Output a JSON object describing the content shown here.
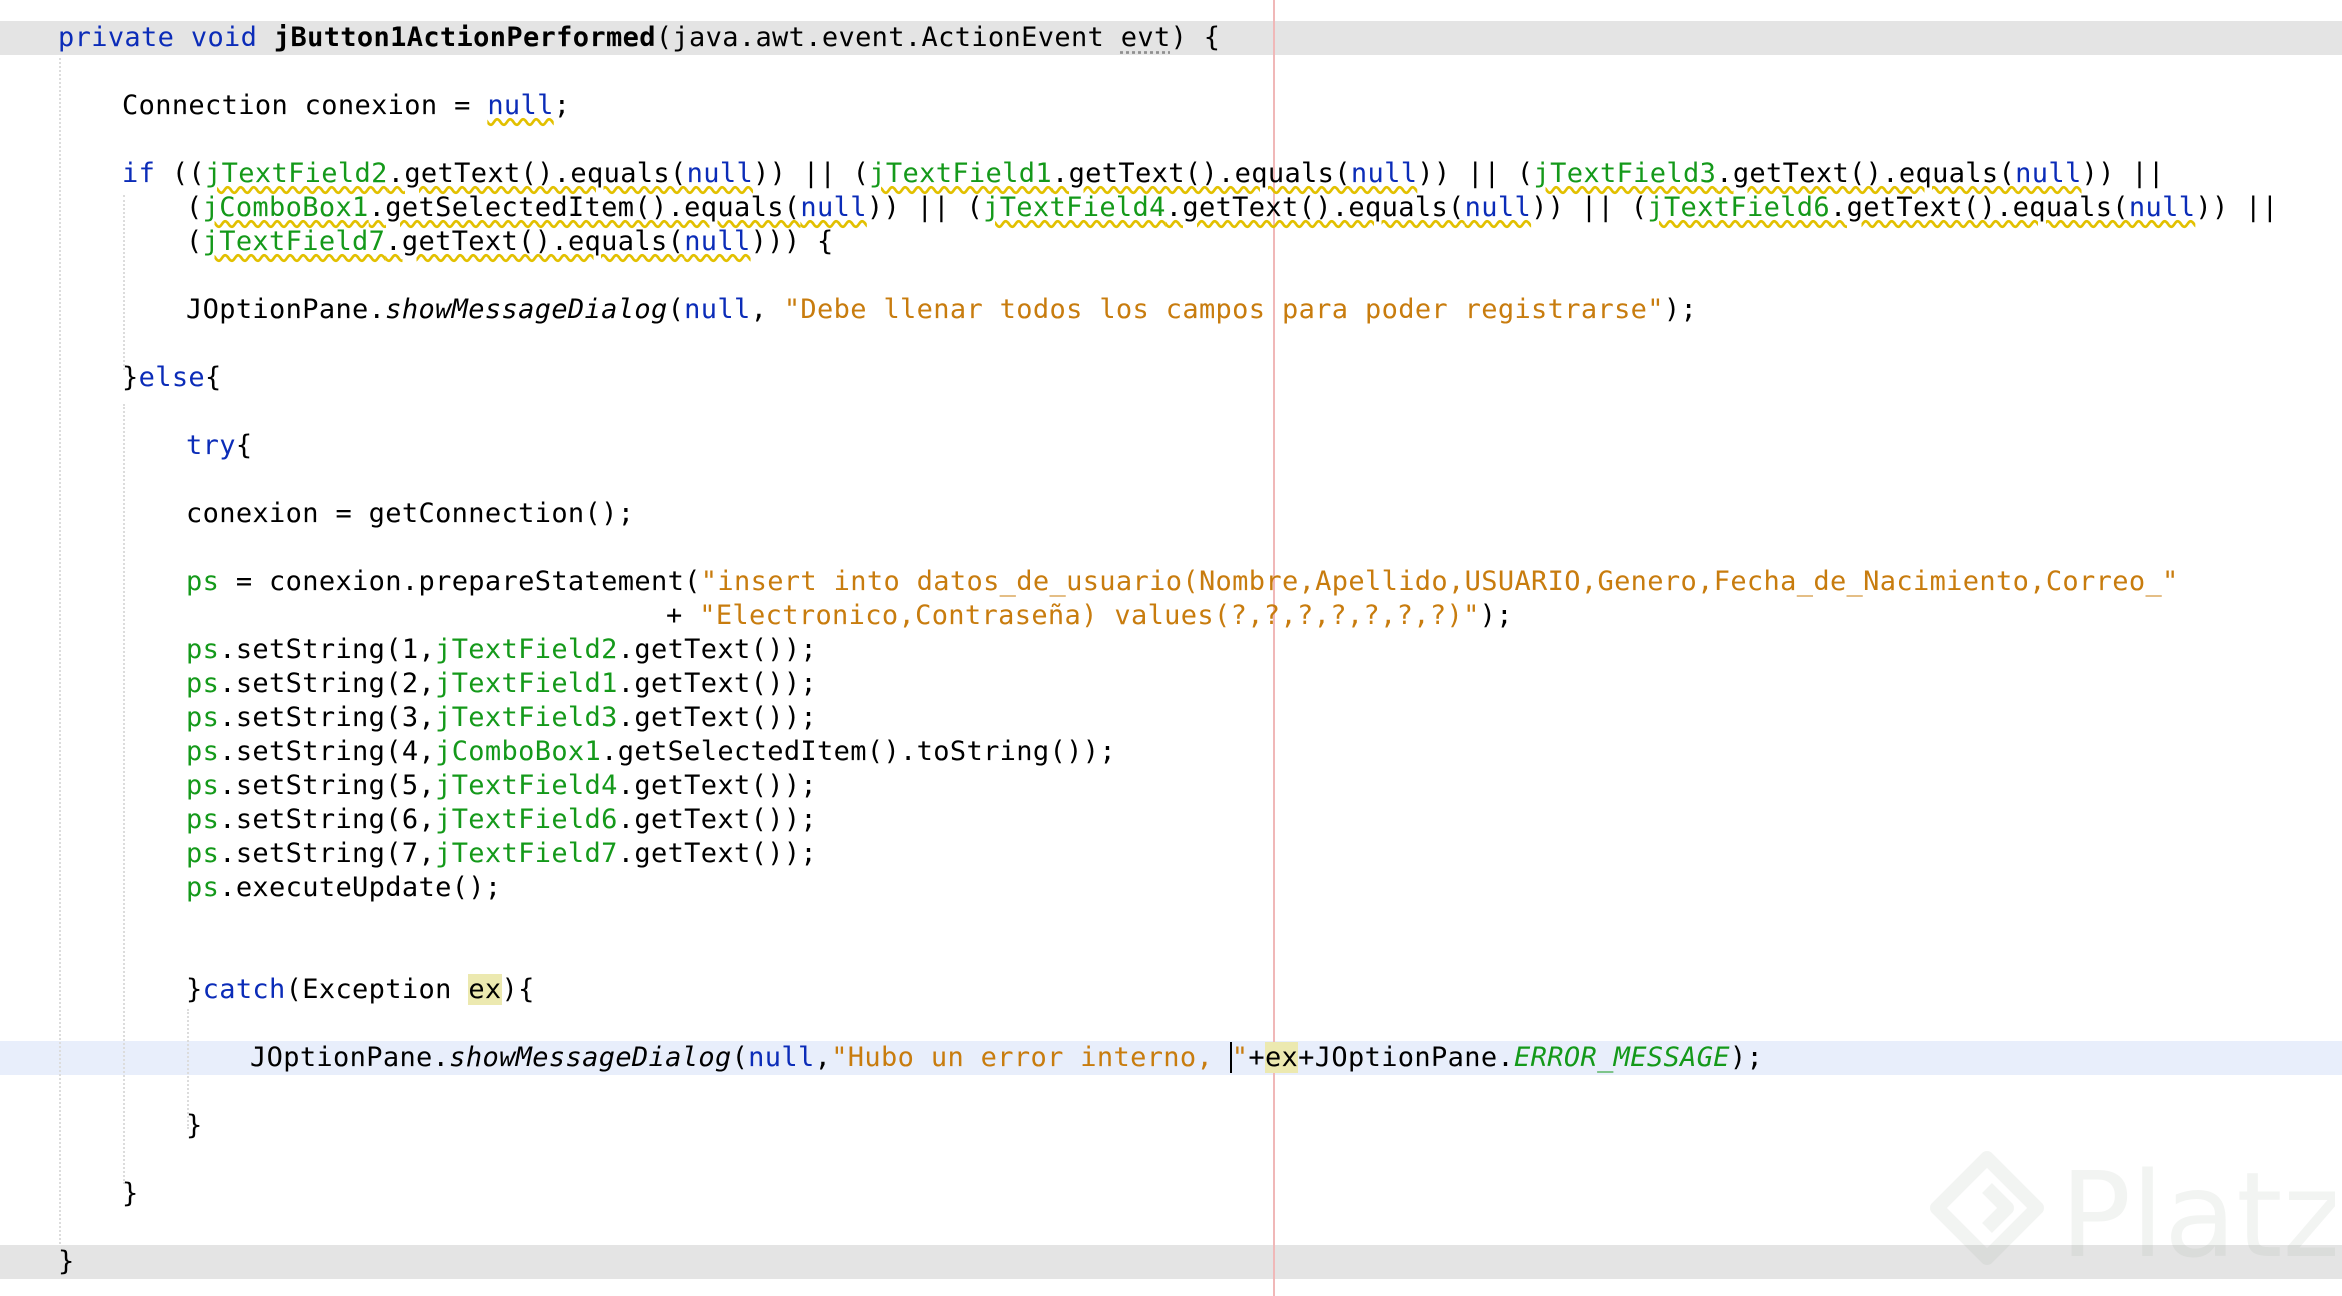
{
  "editor": {
    "colors": {
      "keyword": "#0b2cb8",
      "field": "#14991a",
      "string": "#c87c0e",
      "highlight_line": "#e4e4e4",
      "caret_line": "#e8eefb",
      "right_margin": "#f0b8b8"
    },
    "lines": [
      {
        "tokens": [
          {
            "t": "private void ",
            "c": "kw"
          },
          {
            "t": "jButton1ActionPerformed",
            "c": "fn"
          },
          {
            "t": "(java.awt.event.ActionEvent "
          },
          {
            "t": "evt",
            "c": "unused"
          },
          {
            "t": ") {"
          }
        ]
      },
      {
        "tokens": [
          {
            "t": "Connection conexion = "
          },
          {
            "t": "null",
            "c": "kw warn"
          },
          {
            "t": ";"
          }
        ]
      },
      {
        "tokens": [
          {
            "t": "if",
            "c": "kw"
          },
          {
            "t": " (("
          },
          {
            "t": "jTextField2",
            "c": "fld warn"
          },
          {
            "t": ".getText().equals(",
            "c": "warn"
          },
          {
            "t": "null",
            "c": "kw warn"
          },
          {
            "t": ")) || ("
          },
          {
            "t": "jTextField1",
            "c": "fld warn"
          },
          {
            "t": ".getText().equals(",
            "c": "warn"
          },
          {
            "t": "null",
            "c": "kw warn"
          },
          {
            "t": ")) || ("
          },
          {
            "t": "jTextField3",
            "c": "fld warn"
          },
          {
            "t": ".getText().equals(",
            "c": "warn"
          },
          {
            "t": "null",
            "c": "kw warn"
          },
          {
            "t": ")) ||"
          }
        ]
      },
      {
        "tokens": [
          {
            "t": "("
          },
          {
            "t": "jComboBox1",
            "c": "fld warn"
          },
          {
            "t": ".getSelectedItem().equals(",
            "c": "warn"
          },
          {
            "t": "null",
            "c": "kw warn"
          },
          {
            "t": ")) || ("
          },
          {
            "t": "jTextField4",
            "c": "fld warn"
          },
          {
            "t": ".getText().equals(",
            "c": "warn"
          },
          {
            "t": "null",
            "c": "kw warn"
          },
          {
            "t": ")) || ("
          },
          {
            "t": "jTextField6",
            "c": "fld warn"
          },
          {
            "t": ".getText().equals(",
            "c": "warn"
          },
          {
            "t": "null",
            "c": "kw warn"
          },
          {
            "t": ")) ||"
          }
        ]
      },
      {
        "tokens": [
          {
            "t": "("
          },
          {
            "t": "jTextField7",
            "c": "fld warn"
          },
          {
            "t": ".getText().equals(",
            "c": "warn"
          },
          {
            "t": "null",
            "c": "kw warn"
          },
          {
            "t": "))) {"
          }
        ]
      },
      {
        "tokens": [
          {
            "t": "JOptionPane."
          },
          {
            "t": "showMessageDialog",
            "c": "it"
          },
          {
            "t": "("
          },
          {
            "t": "null",
            "c": "kw"
          },
          {
            "t": ", "
          },
          {
            "t": "\"Debe llenar todos los campos para poder registrarse\"",
            "c": "str"
          },
          {
            "t": ");"
          }
        ]
      },
      {
        "tokens": [
          {
            "t": "}"
          },
          {
            "t": "else",
            "c": "kw"
          },
          {
            "t": "{"
          }
        ]
      },
      {
        "tokens": [
          {
            "t": "try",
            "c": "kw"
          },
          {
            "t": "{"
          }
        ]
      },
      {
        "tokens": [
          {
            "t": "conexion = getConnection();"
          }
        ]
      },
      {
        "tokens": [
          {
            "t": "ps",
            "c": "fld"
          },
          {
            "t": " = conexion.prepareStatement("
          },
          {
            "t": "\"insert into datos_de_usuario(Nombre,Apellido,USUARIO,Genero,Fecha_de_Nacimiento,Correo_\"",
            "c": "str"
          }
        ]
      },
      {
        "tokens": [
          {
            "t": "+ "
          },
          {
            "t": "\"Electronico,Contraseña) values(?,?,?,?,?,?,?)\"",
            "c": "str"
          },
          {
            "t": ");"
          }
        ]
      },
      {
        "tokens": [
          {
            "t": "ps",
            "c": "fld"
          },
          {
            "t": ".setString(1,"
          },
          {
            "t": "jTextField2",
            "c": "fld"
          },
          {
            "t": ".getText());"
          }
        ]
      },
      {
        "tokens": [
          {
            "t": "ps",
            "c": "fld"
          },
          {
            "t": ".setString(2,"
          },
          {
            "t": "jTextField1",
            "c": "fld"
          },
          {
            "t": ".getText());"
          }
        ]
      },
      {
        "tokens": [
          {
            "t": "ps",
            "c": "fld"
          },
          {
            "t": ".setString(3,"
          },
          {
            "t": "jTextField3",
            "c": "fld"
          },
          {
            "t": ".getText());"
          }
        ]
      },
      {
        "tokens": [
          {
            "t": "ps",
            "c": "fld"
          },
          {
            "t": ".setString(4,"
          },
          {
            "t": "jComboBox1",
            "c": "fld"
          },
          {
            "t": ".getSelectedItem().toString());"
          }
        ]
      },
      {
        "tokens": [
          {
            "t": "ps",
            "c": "fld"
          },
          {
            "t": ".setString(5,"
          },
          {
            "t": "jTextField4",
            "c": "fld"
          },
          {
            "t": ".getText());"
          }
        ]
      },
      {
        "tokens": [
          {
            "t": "ps",
            "c": "fld"
          },
          {
            "t": ".setString(6,"
          },
          {
            "t": "jTextField6",
            "c": "fld"
          },
          {
            "t": ".getText());"
          }
        ]
      },
      {
        "tokens": [
          {
            "t": "ps",
            "c": "fld"
          },
          {
            "t": ".setString(7,"
          },
          {
            "t": "jTextField7",
            "c": "fld"
          },
          {
            "t": ".getText());"
          }
        ]
      },
      {
        "tokens": [
          {
            "t": "ps",
            "c": "fld"
          },
          {
            "t": ".executeUpdate();"
          }
        ]
      },
      {
        "tokens": [
          {
            "t": "}"
          },
          {
            "t": "catch",
            "c": "kw"
          },
          {
            "t": "(Exception "
          },
          {
            "t": "ex",
            "c": "mark"
          },
          {
            "t": "){"
          }
        ]
      },
      {
        "tokens": [
          {
            "t": "JOptionPane."
          },
          {
            "t": "showMessageDialog",
            "c": "it"
          },
          {
            "t": "("
          },
          {
            "t": "null",
            "c": "kw"
          },
          {
            "t": ","
          },
          {
            "t": "\"Hubo un error interno, ",
            "c": "str"
          },
          {
            "t": "\"",
            "c": "str cursor-mark"
          },
          {
            "t": "+"
          },
          {
            "t": "ex",
            "c": "mark"
          },
          {
            "t": "+JOptionPane."
          },
          {
            "t": "ERROR_MESSAGE",
            "c": "const"
          },
          {
            "t": ");"
          }
        ]
      },
      {
        "tokens": [
          {
            "t": "}"
          }
        ]
      },
      {
        "tokens": [
          {
            "t": "}"
          }
        ]
      },
      {
        "tokens": [
          {
            "t": "}"
          }
        ]
      }
    ]
  },
  "watermark": {
    "brand": "Platzi"
  }
}
